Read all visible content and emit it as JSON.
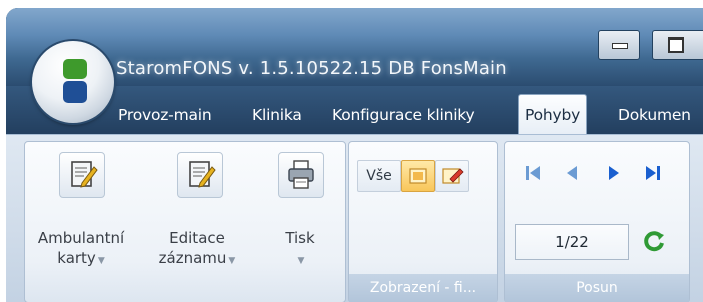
{
  "window": {
    "title": "StaromFONS v. 1.5.10522.15 DB FonsMain"
  },
  "tabs": [
    {
      "label": "Provoz-main",
      "active": false
    },
    {
      "label": "Klinika",
      "active": false
    },
    {
      "label": "Konfigurace kliniky",
      "active": false
    },
    {
      "label": "Pohyby",
      "active": true
    },
    {
      "label": "Dokumen",
      "active": false
    }
  ],
  "ribbon": {
    "group1": {
      "buttons": [
        {
          "line1": "Ambulantní",
          "line2": "karty",
          "icon": "document-edit-icon"
        },
        {
          "line1": "Editace",
          "line2": "záznamu",
          "icon": "document-edit-icon"
        },
        {
          "line1": "Tisk",
          "line2": "",
          "icon": "printer-icon"
        }
      ]
    },
    "filter_group": {
      "label": "Zobrazení - fi...",
      "vse_label": "Vše"
    },
    "posun_group": {
      "label": "Posun",
      "counter": "1/22"
    }
  },
  "colors": {
    "title_bar": "#4f7ba8",
    "tab_bar": "#2b4f75",
    "ribbon": "#d5e1ee",
    "logo_green": "#3e9a2c",
    "logo_blue": "#1f4f96"
  }
}
